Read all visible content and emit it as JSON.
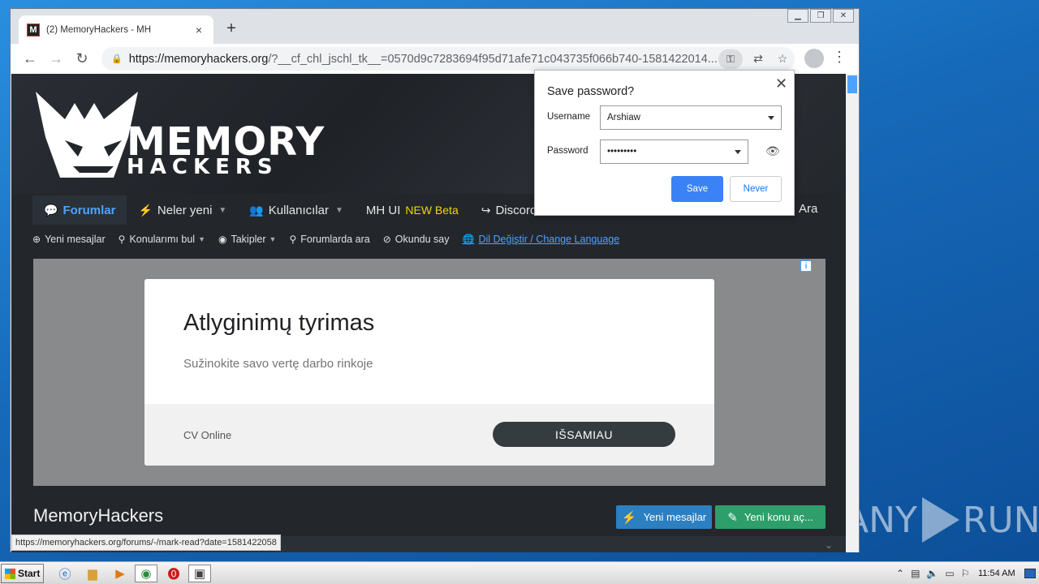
{
  "browser": {
    "tab_title": "(2) MemoryHackers - MH",
    "tab_favicon": "M",
    "tab_close": "×",
    "new_tab": "+",
    "url_host": "https://memoryhackers.org",
    "url_rest": "/?__cf_chl_jschl_tk__=0570d9c7283694f95d71afe71c043735f066b740-1581422014...",
    "status_url": "https://memoryhackers.org/forums/-/mark-read?date=1581422058"
  },
  "site": {
    "logo_line1": "MEMORY",
    "logo_line2": "HACKERS",
    "nav": [
      {
        "label": "Forumlar"
      },
      {
        "label": "Neler yeni"
      },
      {
        "label": "Kullanıcılar"
      },
      {
        "label": "MH UI",
        "badge": "NEW Beta"
      },
      {
        "label": "Discord"
      }
    ],
    "nav_search": "Ara",
    "subnav": [
      {
        "label": "Yeni mesajlar"
      },
      {
        "label": "Konularımı bul"
      },
      {
        "label": "Takipler"
      },
      {
        "label": "Forumlarda ara"
      },
      {
        "label": "Okundu say"
      },
      {
        "label": "Dil Değiştir / Change Language"
      }
    ],
    "title": "MemoryHackers",
    "btn_new_messages": "Yeni mesajlar",
    "btn_new_topic": "Yeni konu aç..."
  },
  "ad": {
    "info_icon": "i",
    "title": "Atlyginimų tyrimas",
    "subtitle": "Sužinokite savo vertę darbo rinkoje",
    "brand": "CV Online",
    "cta": "IŠSAMIAU"
  },
  "password_popup": {
    "title": "Save password?",
    "username_label": "Username",
    "username_value": "Arshiaw",
    "password_label": "Password",
    "password_value": "•••••••••",
    "save_label": "Save",
    "never_label": "Never"
  },
  "taskbar": {
    "start_label": "Start",
    "clock": "11:54 AM"
  },
  "watermark": {
    "left": "ANY",
    "right": "RUN"
  }
}
